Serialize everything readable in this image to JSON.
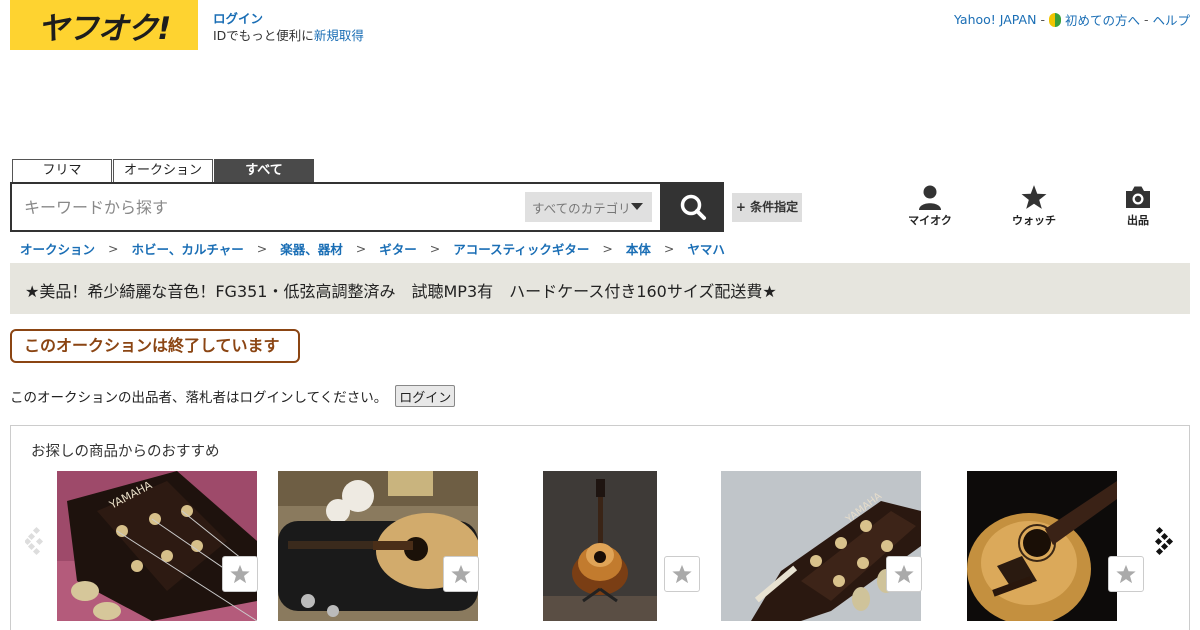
{
  "header": {
    "logo_text": "ヤフオク!",
    "login_label": "ログイン",
    "signup_prefix": "IDでもっと便利に",
    "signup_link": "新規取得",
    "top_links": [
      "Yahoo! JAPAN",
      "初めての方へ",
      "ヘルプ"
    ],
    "top_separator": "-"
  },
  "search": {
    "tabs": [
      {
        "label": "フリマ",
        "active": false
      },
      {
        "label": "オークション",
        "active": false
      },
      {
        "label": "すべて",
        "active": true
      }
    ],
    "placeholder": "キーワードから探す",
    "category_selected": "すべてのカテゴリ",
    "condition_button": "+ 条件指定"
  },
  "nav_icons": [
    {
      "label": "マイオク",
      "icon": "user-icon"
    },
    {
      "label": "ウォッチ",
      "icon": "star-icon"
    },
    {
      "label": "出品",
      "icon": "camera-icon"
    }
  ],
  "breadcrumb": [
    "オークション",
    "ホビー、カルチャー",
    "楽器、器材",
    "ギター",
    "アコースティックギター",
    "本体",
    "ヤマハ"
  ],
  "breadcrumb_separator": ">",
  "item_title": "★美品！希少綺麗な音色！FG351・低弦高調整済み　試聴MP3有　ハードケース付き160サイズ配送費★",
  "ended_badge": "このオークションは終了しています",
  "login_notice": {
    "text": "このオークションの出品者、落札者はログインしてください。",
    "button": "ログイン"
  },
  "recommend": {
    "heading": "お探しの商品からのおすすめ",
    "items": [
      {
        "image": "guitar-headstock-pink"
      },
      {
        "image": "guitar-in-case"
      },
      {
        "image": "guitar-sunburst-standing"
      },
      {
        "image": "guitar-headstock-carpet"
      },
      {
        "image": "guitar-natural-body"
      }
    ]
  },
  "colors": {
    "brand_yellow": "#fed330",
    "link_blue": "#1a6eb5",
    "ended_brown": "#8b4513",
    "title_bg": "#e6e5de"
  }
}
